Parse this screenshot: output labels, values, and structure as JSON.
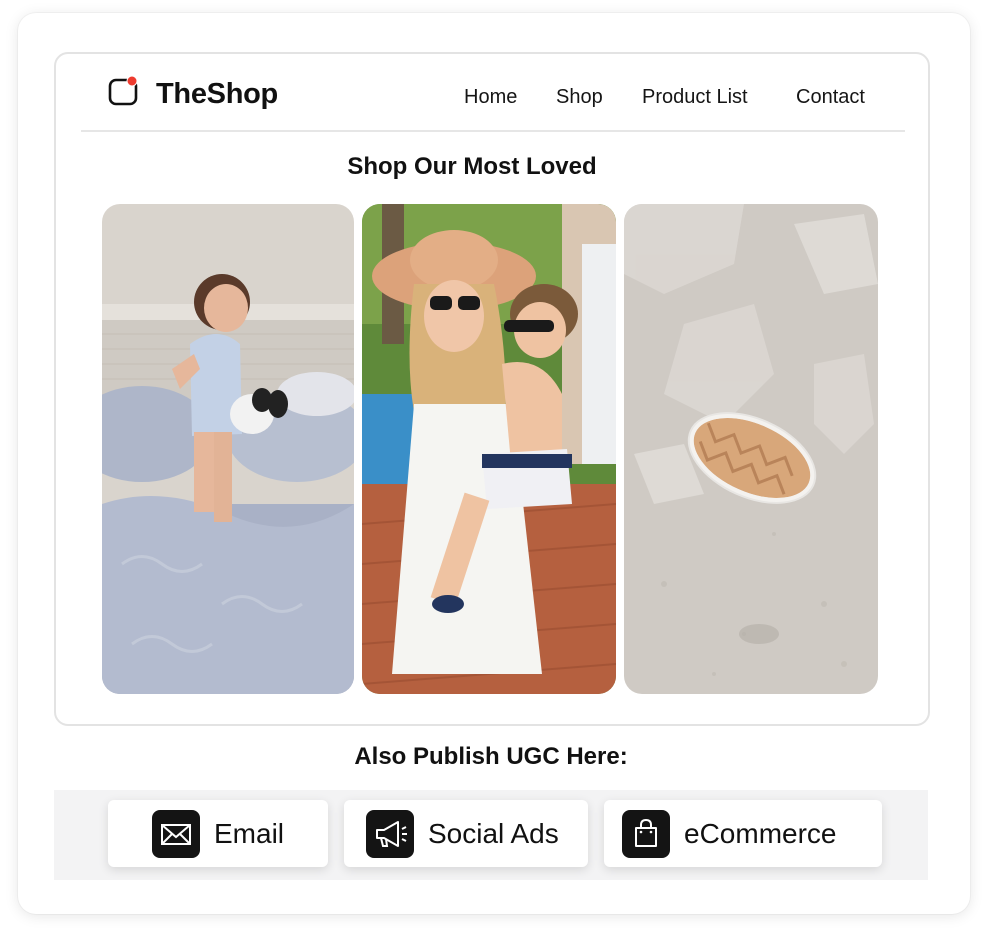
{
  "brand": {
    "name": "TheShop",
    "accent": "#ee3b2f"
  },
  "nav": [
    {
      "label": "Home"
    },
    {
      "label": "Shop"
    },
    {
      "label": "Product List"
    },
    {
      "label": "Contact"
    }
  ],
  "featured": {
    "title": "Shop Our Most Loved",
    "photos": [
      {
        "subject": "toddler-jumping-on-bed"
      },
      {
        "subject": "mother-holding-child-by-pool"
      },
      {
        "subject": "gold-ring-on-sand"
      }
    ]
  },
  "publish": {
    "title": "Also Publish UGC Here:",
    "channels": [
      {
        "label": "Email",
        "icon": "envelope-icon"
      },
      {
        "label": "Social Ads",
        "icon": "megaphone-icon"
      },
      {
        "label": "eCommerce",
        "icon": "shopping-bag-icon"
      }
    ]
  }
}
